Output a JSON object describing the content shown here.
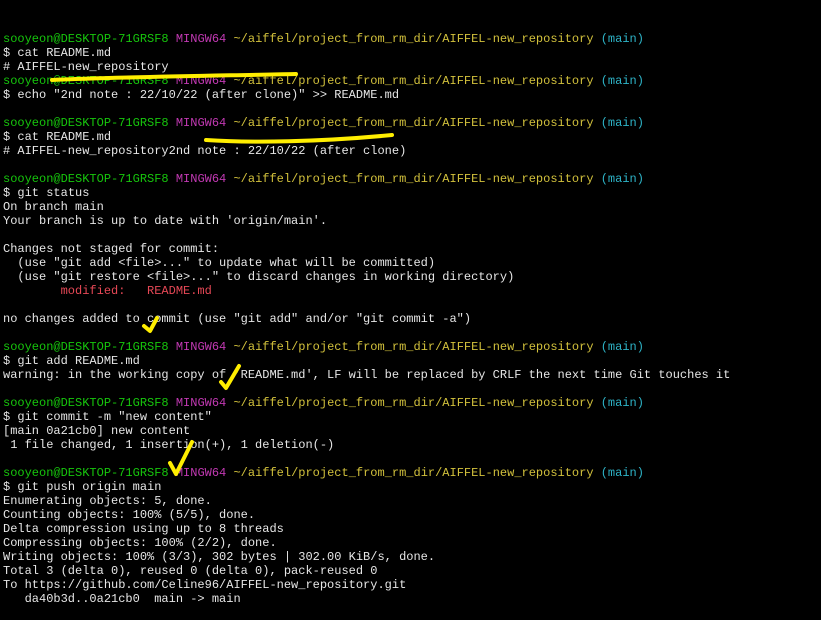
{
  "terminal": {
    "prompt": {
      "user_host": "sooyeon@DESKTOP-71GRSF8",
      "shell": "MINGW64",
      "path": "~/aiffel/project_from_rm_dir/AIFFEL-new_repository",
      "branch": "(main)",
      "symbol": "$"
    },
    "blocks": [
      {
        "command": "cat README.md",
        "output": [
          "# AIFFEL-new_repository"
        ]
      },
      {
        "command": "echo \"2nd note : 22/10/22 (after clone)\" >> README.md",
        "output": [
          ""
        ]
      },
      {
        "command": "cat README.md",
        "output": [
          "# AIFFEL-new_repository2nd note : 22/10/22 (after clone)",
          ""
        ]
      },
      {
        "command": "git status",
        "output": [
          "On branch main",
          "Your branch is up to date with 'origin/main'.",
          "",
          "Changes not staged for commit:",
          "  (use \"git add <file>...\" to update what will be committed)",
          "  (use \"git restore <file>...\" to discard changes in working directory)"
        ],
        "modified_label": "        modified:   README.md",
        "output_after": [
          "",
          "no changes added to commit (use \"git add\" and/or \"git commit -a\")",
          ""
        ]
      },
      {
        "command": "git add README.md",
        "output": [
          "warning: in the working copy of 'README.md', LF will be replaced by CRLF the next time Git touches it",
          ""
        ]
      },
      {
        "command": "git commit -m \"new content\"",
        "output": [
          "[main 0a21cb0] new content",
          " 1 file changed, 1 insertion(+), 1 deletion(-)",
          ""
        ]
      },
      {
        "command": "git push origin main",
        "output": [
          "Enumerating objects: 5, done.",
          "Counting objects: 100% (5/5), done.",
          "Delta compression using up to 8 threads",
          "Compressing objects: 100% (2/2), done.",
          "Writing objects: 100% (3/3), 302 bytes | 302.00 KiB/s, done.",
          "Total 3 (delta 0), reused 0 (delta 0), pack-reused 0",
          "To https://github.com/Celine96/AIFFEL-new_repository.git",
          "   da40b3d..0a21cb0  main -> main"
        ]
      }
    ]
  },
  "annotations": {
    "color": "#ffee00",
    "marks": [
      "underline-echo",
      "underline-cat-output",
      "check-git-add",
      "check-git-commit",
      "check-git-push"
    ]
  }
}
